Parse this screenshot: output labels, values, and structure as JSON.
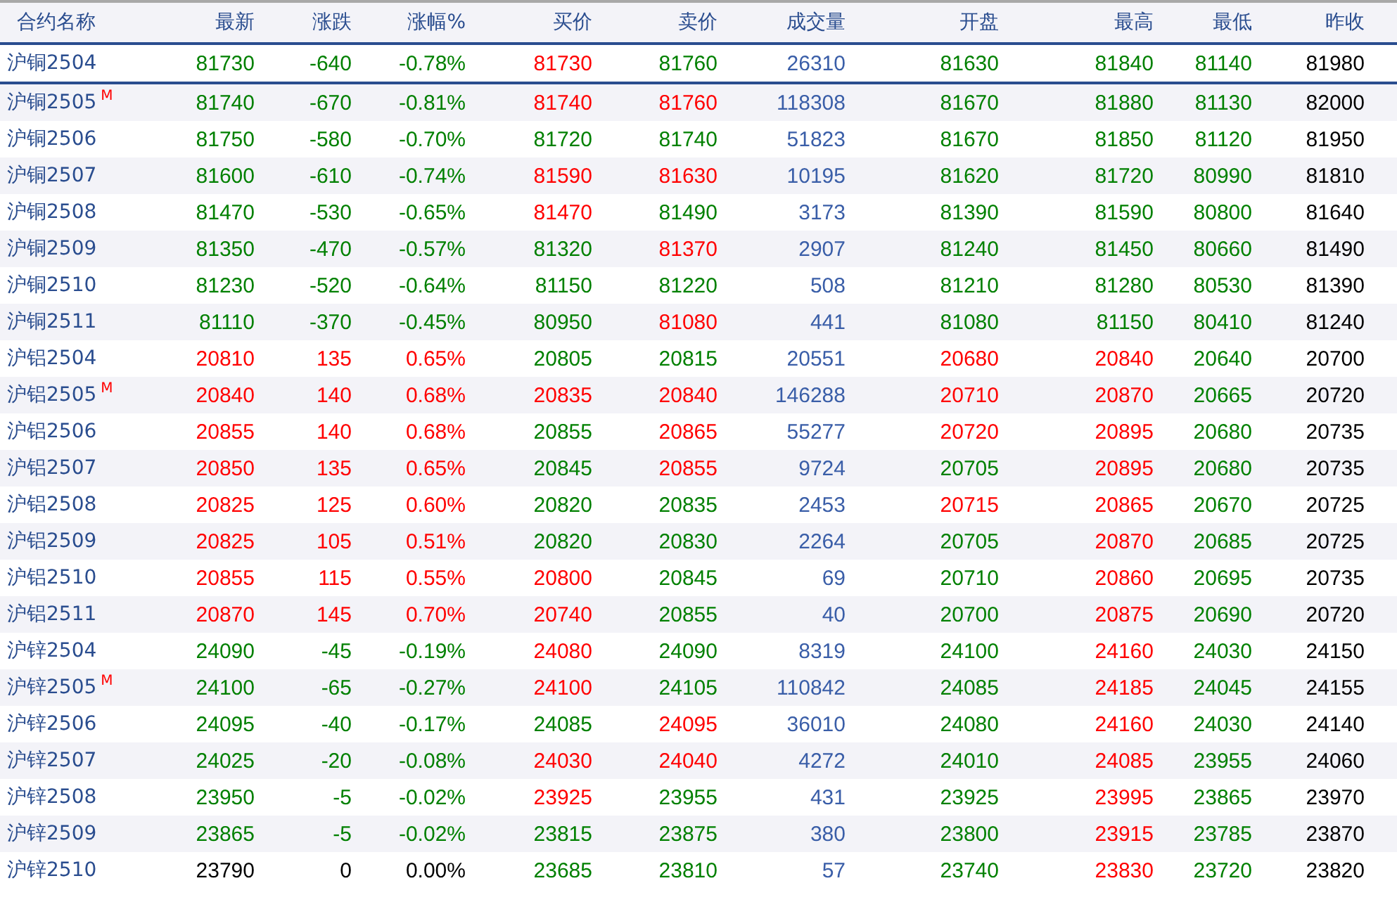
{
  "columns": [
    "合约名称",
    "最新",
    "涨跌",
    "涨幅%",
    "买价",
    "卖价",
    "成交量",
    "开盘",
    "最高",
    "最低",
    "昨收"
  ],
  "rows": [
    {
      "contract": "沪铜2504",
      "selected": true,
      "cells": [
        {
          "text": "81730",
          "color": "#008000"
        },
        {
          "text": "-640",
          "color": "#008000"
        },
        {
          "text": "-0.78%",
          "color": "#008000"
        },
        {
          "text": "81730",
          "color": "#ff0000"
        },
        {
          "text": "81760",
          "color": "#008000"
        },
        {
          "text": "26310",
          "color": "#3a5ea8"
        },
        {
          "text": "81630",
          "color": "#008000"
        },
        {
          "text": "81840",
          "color": "#008000"
        },
        {
          "text": "81140",
          "color": "#008000"
        },
        {
          "text": "81980",
          "color": "#000000"
        }
      ]
    },
    {
      "contract": "沪铜2505",
      "badge": "M",
      "selected": false,
      "cells": [
        {
          "text": "81740",
          "color": "#008000"
        },
        {
          "text": "-670",
          "color": "#008000"
        },
        {
          "text": "-0.81%",
          "color": "#008000"
        },
        {
          "text": "81740",
          "color": "#ff0000"
        },
        {
          "text": "81760",
          "color": "#ff0000"
        },
        {
          "text": "118308",
          "color": "#3a5ea8"
        },
        {
          "text": "81670",
          "color": "#008000"
        },
        {
          "text": "81880",
          "color": "#008000"
        },
        {
          "text": "81130",
          "color": "#008000"
        },
        {
          "text": "82000",
          "color": "#000000"
        }
      ]
    },
    {
      "contract": "沪铜2506",
      "selected": false,
      "cells": [
        {
          "text": "81750",
          "color": "#008000"
        },
        {
          "text": "-580",
          "color": "#008000"
        },
        {
          "text": "-0.70%",
          "color": "#008000"
        },
        {
          "text": "81720",
          "color": "#008000"
        },
        {
          "text": "81740",
          "color": "#008000"
        },
        {
          "text": "51823",
          "color": "#3a5ea8"
        },
        {
          "text": "81670",
          "color": "#008000"
        },
        {
          "text": "81850",
          "color": "#008000"
        },
        {
          "text": "81120",
          "color": "#008000"
        },
        {
          "text": "81950",
          "color": "#000000"
        }
      ]
    },
    {
      "contract": "沪铜2507",
      "selected": false,
      "cells": [
        {
          "text": "81600",
          "color": "#008000"
        },
        {
          "text": "-610",
          "color": "#008000"
        },
        {
          "text": "-0.74%",
          "color": "#008000"
        },
        {
          "text": "81590",
          "color": "#ff0000"
        },
        {
          "text": "81630",
          "color": "#ff0000"
        },
        {
          "text": "10195",
          "color": "#3a5ea8"
        },
        {
          "text": "81620",
          "color": "#008000"
        },
        {
          "text": "81720",
          "color": "#008000"
        },
        {
          "text": "80990",
          "color": "#008000"
        },
        {
          "text": "81810",
          "color": "#000000"
        }
      ]
    },
    {
      "contract": "沪铜2508",
      "selected": false,
      "cells": [
        {
          "text": "81470",
          "color": "#008000"
        },
        {
          "text": "-530",
          "color": "#008000"
        },
        {
          "text": "-0.65%",
          "color": "#008000"
        },
        {
          "text": "81470",
          "color": "#ff0000"
        },
        {
          "text": "81490",
          "color": "#008000"
        },
        {
          "text": "3173",
          "color": "#3a5ea8"
        },
        {
          "text": "81390",
          "color": "#008000"
        },
        {
          "text": "81590",
          "color": "#008000"
        },
        {
          "text": "80800",
          "color": "#008000"
        },
        {
          "text": "81640",
          "color": "#000000"
        }
      ]
    },
    {
      "contract": "沪铜2509",
      "selected": false,
      "cells": [
        {
          "text": "81350",
          "color": "#008000"
        },
        {
          "text": "-470",
          "color": "#008000"
        },
        {
          "text": "-0.57%",
          "color": "#008000"
        },
        {
          "text": "81320",
          "color": "#008000"
        },
        {
          "text": "81370",
          "color": "#ff0000"
        },
        {
          "text": "2907",
          "color": "#3a5ea8"
        },
        {
          "text": "81240",
          "color": "#008000"
        },
        {
          "text": "81450",
          "color": "#008000"
        },
        {
          "text": "80660",
          "color": "#008000"
        },
        {
          "text": "81490",
          "color": "#000000"
        }
      ]
    },
    {
      "contract": "沪铜2510",
      "selected": false,
      "cells": [
        {
          "text": "81230",
          "color": "#008000"
        },
        {
          "text": "-520",
          "color": "#008000"
        },
        {
          "text": "-0.64%",
          "color": "#008000"
        },
        {
          "text": "81150",
          "color": "#008000"
        },
        {
          "text": "81220",
          "color": "#008000"
        },
        {
          "text": "508",
          "color": "#3a5ea8"
        },
        {
          "text": "81210",
          "color": "#008000"
        },
        {
          "text": "81280",
          "color": "#008000"
        },
        {
          "text": "80530",
          "color": "#008000"
        },
        {
          "text": "81390",
          "color": "#000000"
        }
      ]
    },
    {
      "contract": "沪铜2511",
      "selected": false,
      "cells": [
        {
          "text": "81110",
          "color": "#008000"
        },
        {
          "text": "-370",
          "color": "#008000"
        },
        {
          "text": "-0.45%",
          "color": "#008000"
        },
        {
          "text": "80950",
          "color": "#008000"
        },
        {
          "text": "81080",
          "color": "#ff0000"
        },
        {
          "text": "441",
          "color": "#3a5ea8"
        },
        {
          "text": "81080",
          "color": "#008000"
        },
        {
          "text": "81150",
          "color": "#008000"
        },
        {
          "text": "80410",
          "color": "#008000"
        },
        {
          "text": "81240",
          "color": "#000000"
        }
      ]
    },
    {
      "contract": "沪铝2504",
      "selected": false,
      "cells": [
        {
          "text": "20810",
          "color": "#ff0000"
        },
        {
          "text": "135",
          "color": "#ff0000"
        },
        {
          "text": "0.65%",
          "color": "#ff0000"
        },
        {
          "text": "20805",
          "color": "#008000"
        },
        {
          "text": "20815",
          "color": "#008000"
        },
        {
          "text": "20551",
          "color": "#3a5ea8"
        },
        {
          "text": "20680",
          "color": "#ff0000"
        },
        {
          "text": "20840",
          "color": "#ff0000"
        },
        {
          "text": "20640",
          "color": "#008000"
        },
        {
          "text": "20700",
          "color": "#000000"
        }
      ]
    },
    {
      "contract": "沪铝2505",
      "badge": "M",
      "selected": false,
      "cells": [
        {
          "text": "20840",
          "color": "#ff0000"
        },
        {
          "text": "140",
          "color": "#ff0000"
        },
        {
          "text": "0.68%",
          "color": "#ff0000"
        },
        {
          "text": "20835",
          "color": "#ff0000"
        },
        {
          "text": "20840",
          "color": "#ff0000"
        },
        {
          "text": "146288",
          "color": "#3a5ea8"
        },
        {
          "text": "20710",
          "color": "#ff0000"
        },
        {
          "text": "20870",
          "color": "#ff0000"
        },
        {
          "text": "20665",
          "color": "#008000"
        },
        {
          "text": "20720",
          "color": "#000000"
        }
      ]
    },
    {
      "contract": "沪铝2506",
      "selected": false,
      "cells": [
        {
          "text": "20855",
          "color": "#ff0000"
        },
        {
          "text": "140",
          "color": "#ff0000"
        },
        {
          "text": "0.68%",
          "color": "#ff0000"
        },
        {
          "text": "20855",
          "color": "#008000"
        },
        {
          "text": "20865",
          "color": "#ff0000"
        },
        {
          "text": "55277",
          "color": "#3a5ea8"
        },
        {
          "text": "20720",
          "color": "#ff0000"
        },
        {
          "text": "20895",
          "color": "#ff0000"
        },
        {
          "text": "20680",
          "color": "#008000"
        },
        {
          "text": "20735",
          "color": "#000000"
        }
      ]
    },
    {
      "contract": "沪铝2507",
      "selected": false,
      "cells": [
        {
          "text": "20850",
          "color": "#ff0000"
        },
        {
          "text": "135",
          "color": "#ff0000"
        },
        {
          "text": "0.65%",
          "color": "#ff0000"
        },
        {
          "text": "20845",
          "color": "#008000"
        },
        {
          "text": "20855",
          "color": "#ff0000"
        },
        {
          "text": "9724",
          "color": "#3a5ea8"
        },
        {
          "text": "20705",
          "color": "#008000"
        },
        {
          "text": "20895",
          "color": "#ff0000"
        },
        {
          "text": "20680",
          "color": "#008000"
        },
        {
          "text": "20735",
          "color": "#000000"
        }
      ]
    },
    {
      "contract": "沪铝2508",
      "selected": false,
      "cells": [
        {
          "text": "20825",
          "color": "#ff0000"
        },
        {
          "text": "125",
          "color": "#ff0000"
        },
        {
          "text": "0.60%",
          "color": "#ff0000"
        },
        {
          "text": "20820",
          "color": "#008000"
        },
        {
          "text": "20835",
          "color": "#008000"
        },
        {
          "text": "2453",
          "color": "#3a5ea8"
        },
        {
          "text": "20715",
          "color": "#ff0000"
        },
        {
          "text": "20865",
          "color": "#ff0000"
        },
        {
          "text": "20670",
          "color": "#008000"
        },
        {
          "text": "20725",
          "color": "#000000"
        }
      ]
    },
    {
      "contract": "沪铝2509",
      "selected": false,
      "cells": [
        {
          "text": "20825",
          "color": "#ff0000"
        },
        {
          "text": "105",
          "color": "#ff0000"
        },
        {
          "text": "0.51%",
          "color": "#ff0000"
        },
        {
          "text": "20820",
          "color": "#008000"
        },
        {
          "text": "20830",
          "color": "#008000"
        },
        {
          "text": "2264",
          "color": "#3a5ea8"
        },
        {
          "text": "20705",
          "color": "#008000"
        },
        {
          "text": "20870",
          "color": "#ff0000"
        },
        {
          "text": "20685",
          "color": "#008000"
        },
        {
          "text": "20725",
          "color": "#000000"
        }
      ]
    },
    {
      "contract": "沪铝2510",
      "selected": false,
      "cells": [
        {
          "text": "20855",
          "color": "#ff0000"
        },
        {
          "text": "115",
          "color": "#ff0000"
        },
        {
          "text": "0.55%",
          "color": "#ff0000"
        },
        {
          "text": "20800",
          "color": "#ff0000"
        },
        {
          "text": "20845",
          "color": "#008000"
        },
        {
          "text": "69",
          "color": "#3a5ea8"
        },
        {
          "text": "20710",
          "color": "#008000"
        },
        {
          "text": "20860",
          "color": "#ff0000"
        },
        {
          "text": "20695",
          "color": "#008000"
        },
        {
          "text": "20735",
          "color": "#000000"
        }
      ]
    },
    {
      "contract": "沪铝2511",
      "selected": false,
      "cells": [
        {
          "text": "20870",
          "color": "#ff0000"
        },
        {
          "text": "145",
          "color": "#ff0000"
        },
        {
          "text": "0.70%",
          "color": "#ff0000"
        },
        {
          "text": "20740",
          "color": "#ff0000"
        },
        {
          "text": "20855",
          "color": "#008000"
        },
        {
          "text": "40",
          "color": "#3a5ea8"
        },
        {
          "text": "20700",
          "color": "#008000"
        },
        {
          "text": "20875",
          "color": "#ff0000"
        },
        {
          "text": "20690",
          "color": "#008000"
        },
        {
          "text": "20720",
          "color": "#000000"
        }
      ]
    },
    {
      "contract": "沪锌2504",
      "selected": false,
      "cells": [
        {
          "text": "24090",
          "color": "#008000"
        },
        {
          "text": "-45",
          "color": "#008000"
        },
        {
          "text": "-0.19%",
          "color": "#008000"
        },
        {
          "text": "24080",
          "color": "#ff0000"
        },
        {
          "text": "24090",
          "color": "#008000"
        },
        {
          "text": "8319",
          "color": "#3a5ea8"
        },
        {
          "text": "24100",
          "color": "#008000"
        },
        {
          "text": "24160",
          "color": "#ff0000"
        },
        {
          "text": "24030",
          "color": "#008000"
        },
        {
          "text": "24150",
          "color": "#000000"
        }
      ]
    },
    {
      "contract": "沪锌2505",
      "badge": "M",
      "selected": false,
      "cells": [
        {
          "text": "24100",
          "color": "#008000"
        },
        {
          "text": "-65",
          "color": "#008000"
        },
        {
          "text": "-0.27%",
          "color": "#008000"
        },
        {
          "text": "24100",
          "color": "#ff0000"
        },
        {
          "text": "24105",
          "color": "#008000"
        },
        {
          "text": "110842",
          "color": "#3a5ea8"
        },
        {
          "text": "24085",
          "color": "#008000"
        },
        {
          "text": "24185",
          "color": "#ff0000"
        },
        {
          "text": "24045",
          "color": "#008000"
        },
        {
          "text": "24155",
          "color": "#000000"
        }
      ]
    },
    {
      "contract": "沪锌2506",
      "selected": false,
      "cells": [
        {
          "text": "24095",
          "color": "#008000"
        },
        {
          "text": "-40",
          "color": "#008000"
        },
        {
          "text": "-0.17%",
          "color": "#008000"
        },
        {
          "text": "24085",
          "color": "#008000"
        },
        {
          "text": "24095",
          "color": "#ff0000"
        },
        {
          "text": "36010",
          "color": "#3a5ea8"
        },
        {
          "text": "24080",
          "color": "#008000"
        },
        {
          "text": "24160",
          "color": "#ff0000"
        },
        {
          "text": "24030",
          "color": "#008000"
        },
        {
          "text": "24140",
          "color": "#000000"
        }
      ]
    },
    {
      "contract": "沪锌2507",
      "selected": false,
      "cells": [
        {
          "text": "24025",
          "color": "#008000"
        },
        {
          "text": "-20",
          "color": "#008000"
        },
        {
          "text": "-0.08%",
          "color": "#008000"
        },
        {
          "text": "24030",
          "color": "#ff0000"
        },
        {
          "text": "24040",
          "color": "#ff0000"
        },
        {
          "text": "4272",
          "color": "#3a5ea8"
        },
        {
          "text": "24010",
          "color": "#008000"
        },
        {
          "text": "24085",
          "color": "#ff0000"
        },
        {
          "text": "23955",
          "color": "#008000"
        },
        {
          "text": "24060",
          "color": "#000000"
        }
      ]
    },
    {
      "contract": "沪锌2508",
      "selected": false,
      "cells": [
        {
          "text": "23950",
          "color": "#008000"
        },
        {
          "text": "-5",
          "color": "#008000"
        },
        {
          "text": "-0.02%",
          "color": "#008000"
        },
        {
          "text": "23925",
          "color": "#ff0000"
        },
        {
          "text": "23955",
          "color": "#008000"
        },
        {
          "text": "431",
          "color": "#3a5ea8"
        },
        {
          "text": "23925",
          "color": "#008000"
        },
        {
          "text": "23995",
          "color": "#ff0000"
        },
        {
          "text": "23865",
          "color": "#008000"
        },
        {
          "text": "23970",
          "color": "#000000"
        }
      ]
    },
    {
      "contract": "沪锌2509",
      "selected": false,
      "cells": [
        {
          "text": "23865",
          "color": "#008000"
        },
        {
          "text": "-5",
          "color": "#008000"
        },
        {
          "text": "-0.02%",
          "color": "#008000"
        },
        {
          "text": "23815",
          "color": "#008000"
        },
        {
          "text": "23875",
          "color": "#008000"
        },
        {
          "text": "380",
          "color": "#3a5ea8"
        },
        {
          "text": "23800",
          "color": "#008000"
        },
        {
          "text": "23915",
          "color": "#ff0000"
        },
        {
          "text": "23785",
          "color": "#008000"
        },
        {
          "text": "23870",
          "color": "#000000"
        }
      ]
    },
    {
      "contract": "沪锌2510",
      "selected": false,
      "cells": [
        {
          "text": "23790",
          "color": "#000000"
        },
        {
          "text": "0",
          "color": "#000000"
        },
        {
          "text": "0.00%",
          "color": "#000000"
        },
        {
          "text": "23685",
          "color": "#008000"
        },
        {
          "text": "23810",
          "color": "#008000"
        },
        {
          "text": "57",
          "color": "#3a5ea8"
        },
        {
          "text": "23740",
          "color": "#008000"
        },
        {
          "text": "23830",
          "color": "#ff0000"
        },
        {
          "text": "23720",
          "color": "#008000"
        },
        {
          "text": "23820",
          "color": "#000000"
        }
      ]
    }
  ]
}
